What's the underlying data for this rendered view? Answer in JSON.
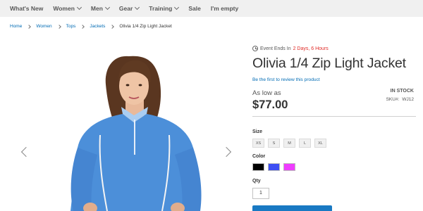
{
  "nav": {
    "items": [
      {
        "label": "What's New",
        "has_menu": false
      },
      {
        "label": "Women",
        "has_menu": true
      },
      {
        "label": "Men",
        "has_menu": true
      },
      {
        "label": "Gear",
        "has_menu": true
      },
      {
        "label": "Training",
        "has_menu": true
      },
      {
        "label": "Sale",
        "has_menu": false
      },
      {
        "label": "I'm empty",
        "has_menu": false
      }
    ]
  },
  "breadcrumb": {
    "items": [
      "Home",
      "Women",
      "Tops",
      "Jackets"
    ],
    "current": "Olivia 1/4 Zip Light Jacket"
  },
  "gallery": {
    "prev_icon": "chevron-left-icon",
    "next_icon": "chevron-right-icon"
  },
  "product": {
    "event_prefix": "Event Ends In",
    "event_time": "2 Days, 6 Hours",
    "title": "Olivia 1/4 Zip Light Jacket",
    "review_link": "Be the first to review this product",
    "as_low_as": "As low as",
    "price": "$77.00",
    "stock": "IN STOCK",
    "sku_label": "SKU#:",
    "sku": "WJ12",
    "size_label": "Size",
    "sizes": [
      "XS",
      "S",
      "M",
      "L",
      "XL"
    ],
    "color_label": "Color",
    "colors": [
      "#000000",
      "#3d4ef3",
      "#ef3dff"
    ],
    "qty_label": "Qty",
    "qty_value": "1",
    "accent_color": "#1979c3",
    "jacket_color": "#4c8fd9"
  }
}
